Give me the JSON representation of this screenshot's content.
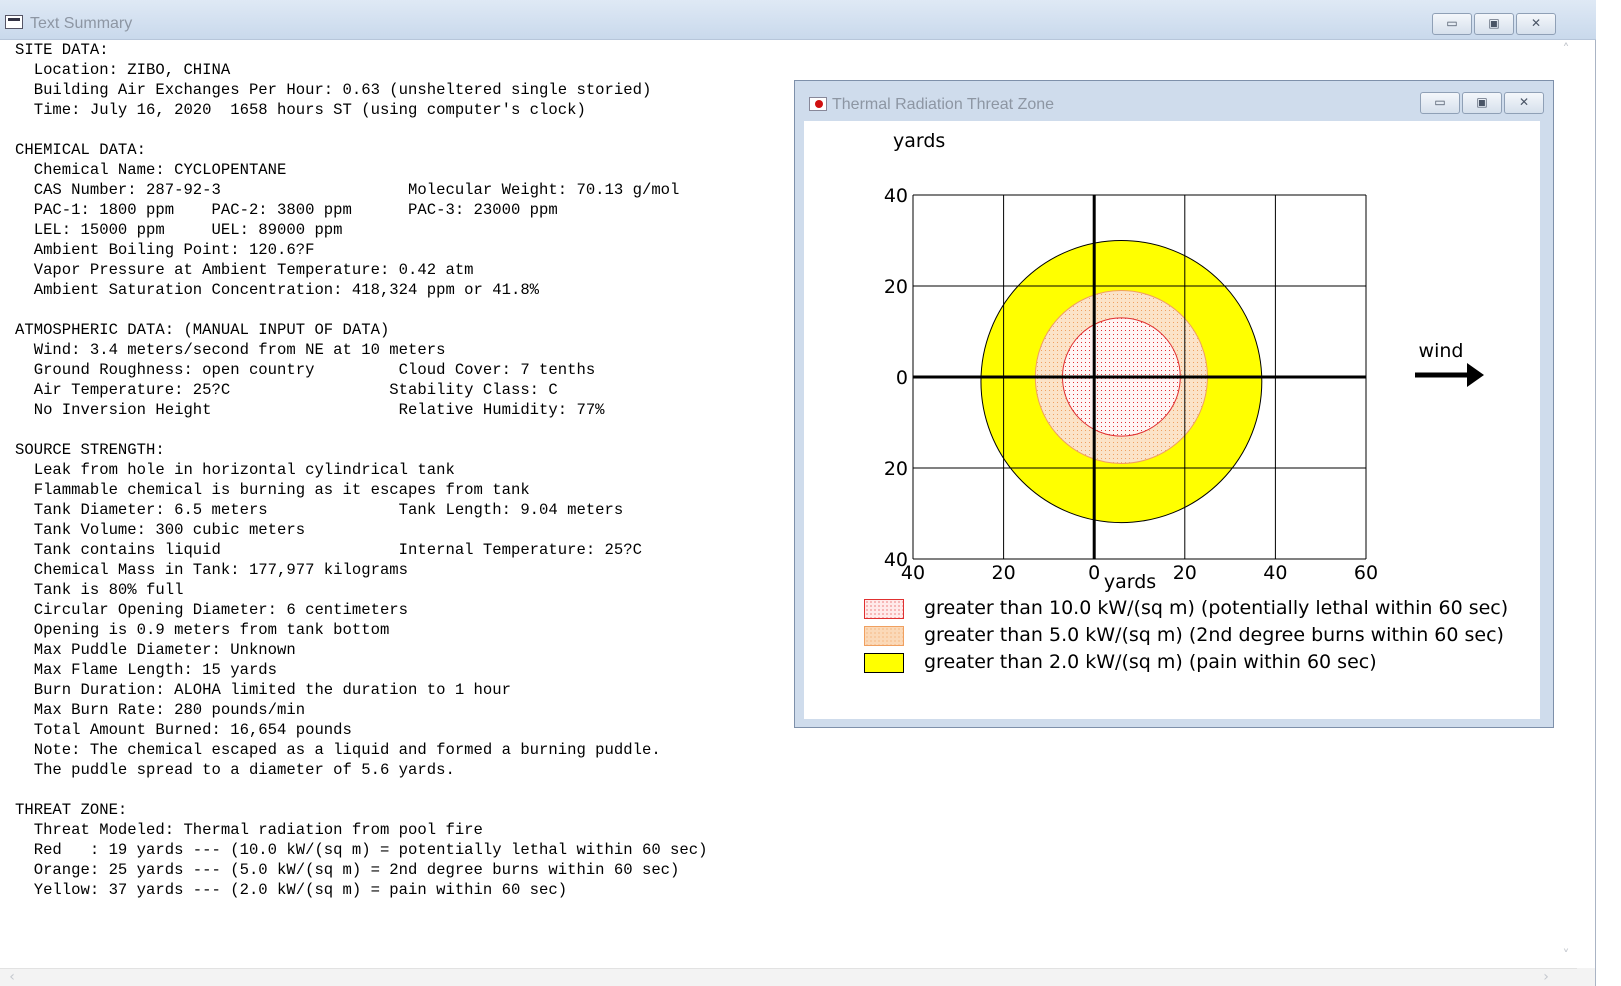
{
  "main_window": {
    "title": "Text Summary",
    "lines": [
      "SITE DATA:",
      "  Location: ZIBO, CHINA",
      "  Building Air Exchanges Per Hour: 0.63 (unsheltered single storied)",
      "  Time: July 16, 2020  1658 hours ST (using computer's clock)",
      "",
      "CHEMICAL DATA:",
      "  Chemical Name: CYCLOPENTANE",
      "  CAS Number: 287-92-3                    Molecular Weight: 70.13 g/mol",
      "  PAC-1: 1800 ppm    PAC-2: 3800 ppm      PAC-3: 23000 ppm",
      "  LEL: 15000 ppm     UEL: 89000 ppm",
      "  Ambient Boiling Point: 120.6?F",
      "  Vapor Pressure at Ambient Temperature: 0.42 atm",
      "  Ambient Saturation Concentration: 418,324 ppm or 41.8%",
      "",
      "ATMOSPHERIC DATA: (MANUAL INPUT OF DATA)",
      "  Wind: 3.4 meters/second from NE at 10 meters",
      "  Ground Roughness: open country         Cloud Cover: 7 tenths",
      "  Air Temperature: 25?C                 Stability Class: C",
      "  No Inversion Height                    Relative Humidity: 77%",
      "",
      "SOURCE STRENGTH:",
      "  Leak from hole in horizontal cylindrical tank",
      "  Flammable chemical is burning as it escapes from tank",
      "  Tank Diameter: 6.5 meters              Tank Length: 9.04 meters",
      "  Tank Volume: 300 cubic meters",
      "  Tank contains liquid                   Internal Temperature: 25?C",
      "  Chemical Mass in Tank: 177,977 kilograms",
      "  Tank is 80% full",
      "  Circular Opening Diameter: 6 centimeters",
      "  Opening is 0.9 meters from tank bottom",
      "  Max Puddle Diameter: Unknown",
      "  Max Flame Length: 15 yards",
      "  Burn Duration: ALOHA limited the duration to 1 hour",
      "  Max Burn Rate: 280 pounds/min",
      "  Total Amount Burned: 16,654 pounds",
      "  Note: The chemical escaped as a liquid and formed a burning puddle.",
      "  The puddle spread to a diameter of 5.6 yards.",
      "",
      "THREAT ZONE:",
      "  Threat Modeled: Thermal radiation from pool fire",
      "  Red   : 19 yards --- (10.0 kW/(sq m) = potentially lethal within 60 sec)",
      "  Orange: 25 yards --- (5.0 kW/(sq m) = 2nd degree burns within 60 sec)",
      "  Yellow: 37 yards --- (2.0 kW/(sq m) = pain within 60 sec)"
    ]
  },
  "threat_window": {
    "title": "Thermal Radiation Threat Zone",
    "y_unit": "yards",
    "x_unit": "yards",
    "wind_label": "wind",
    "y_ticks": [
      "40",
      "20",
      "0",
      "20",
      "40"
    ],
    "x_ticks": [
      "40",
      "20",
      "0",
      "20",
      "40",
      "60"
    ],
    "legend": [
      {
        "label": "greater than 10.0 kW/(sq m) (potentially lethal within 60 sec)",
        "fill": "#ffeaea",
        "border": "#e03030"
      },
      {
        "label": "greater than 5.0 kW/(sq m) (2nd degree burns within 60 sec)",
        "fill": "#fbd9b8",
        "border": "#f0a060"
      },
      {
        "label": "greater than 2.0 kW/(sq m) (pain within 60 sec)",
        "fill": "#ffff00",
        "border": "#000000"
      }
    ]
  },
  "chart_data": {
    "type": "area",
    "title": "",
    "xlabel": "yards",
    "ylabel": "yards",
    "xlim": [
      -40,
      60
    ],
    "ylim": [
      -40,
      40
    ],
    "grid": true,
    "series": [
      {
        "name": "greater than 2.0 kW/(sq m) (pain within 60 sec)",
        "zone_reach_yards": 37,
        "center_x": 6,
        "center_y": -1,
        "half_width": 31,
        "half_height": 31,
        "color": "#ffff00"
      },
      {
        "name": "greater than 5.0 kW/(sq m) (2nd degree burns within 60 sec)",
        "zone_reach_yards": 25,
        "center_x": 6,
        "center_y": 0,
        "half_width": 19,
        "half_height": 19,
        "color": "#fbd9b8"
      },
      {
        "name": "greater than 10.0 kW/(sq m) (potentially lethal within 60 sec)",
        "zone_reach_yards": 19,
        "center_x": 6,
        "center_y": 0,
        "half_width": 13,
        "half_height": 13,
        "color": "#ffeaea"
      }
    ]
  }
}
